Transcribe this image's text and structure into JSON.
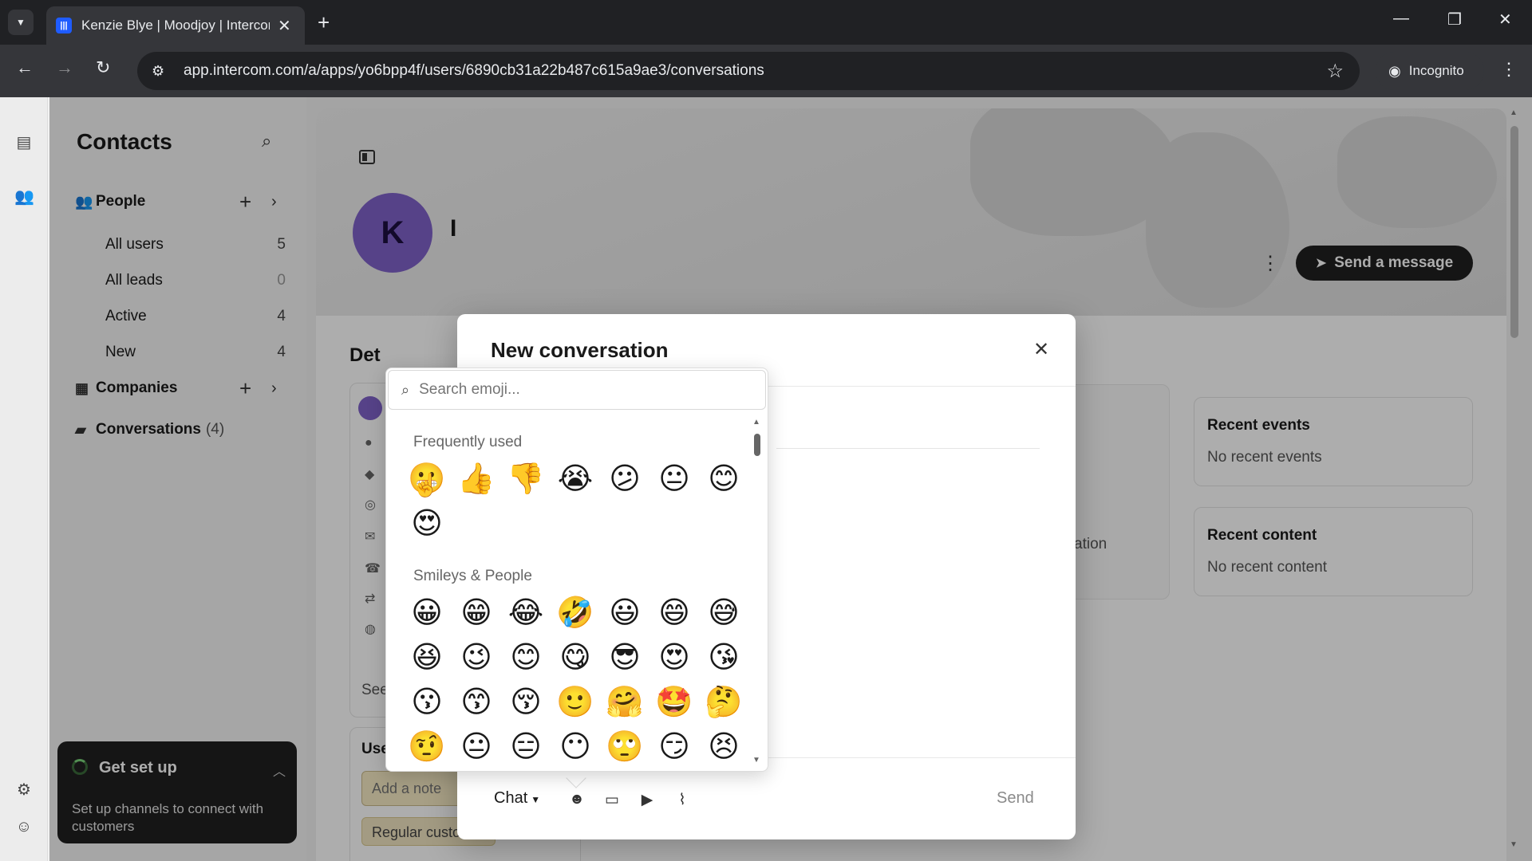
{
  "browser": {
    "tab_title": "Kenzie Blye | Moodjoy | Intercom",
    "favicon_text": "|||",
    "url": "app.intercom.com/a/apps/yo6bpp4f/users/6890cb31a22b487c615a9ae3/conversations",
    "incognito_label": "Incognito"
  },
  "sidebar": {
    "title": "Contacts",
    "people": {
      "label": "People",
      "items": [
        {
          "label": "All users",
          "count": "5"
        },
        {
          "label": "All leads",
          "count": "0"
        },
        {
          "label": "Active",
          "count": "4"
        },
        {
          "label": "New",
          "count": "4"
        }
      ]
    },
    "companies_label": "Companies",
    "conversations_label": "Conversations",
    "conversations_count": "(4)",
    "setup": {
      "title": "Get set up",
      "text": "Set up channels to connect with customers"
    }
  },
  "profile": {
    "avatar_letter": "K",
    "name_peek": "I",
    "send_message_label": "Send a message",
    "details_title": "Det",
    "see_more": "See 25 more",
    "user_notes_title": "User notes",
    "note_placeholder": "Add a note",
    "tag_label": "Regular customer",
    "mid_peek": "ation",
    "recent_events": {
      "title": "Recent events",
      "empty": "No recent events"
    },
    "recent_content": {
      "title": "Recent content",
      "empty": "No recent content"
    }
  },
  "modal": {
    "title": "New conversation",
    "channel_label": "Chat",
    "send_label": "Send"
  },
  "emoji_picker": {
    "search_placeholder": "Search emoji...",
    "frequently_used_label": "Frequently used",
    "frequently_used": [
      "😬",
      "👍",
      "👎",
      "😭",
      "😕",
      "😐",
      "😊",
      "😍"
    ],
    "smileys_label": "Smileys & People",
    "smileys": [
      "😀",
      "😁",
      "😂",
      "🤣",
      "😃",
      "😄",
      "😅",
      "😆",
      "😉",
      "😊",
      "😋",
      "😎",
      "😍",
      "😘",
      "😗",
      "😙",
      "😚",
      "🙂",
      "🤗",
      "🤩",
      "🤔",
      "🤨",
      "😐",
      "😑",
      "😶",
      "🙄",
      "😏",
      "😣"
    ]
  },
  "icons": {
    "search": "search-icon",
    "close": "close-icon",
    "emoji": "emoji-icon",
    "image": "image-icon",
    "video": "video-icon",
    "attach": "attachment-icon"
  },
  "colors": {
    "avatar": "#7f62c9",
    "primary_button": "#1f1f1f",
    "note_bg": "#f7ebc4"
  }
}
